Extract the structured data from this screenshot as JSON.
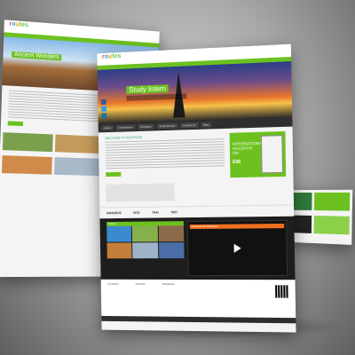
{
  "back_page": {
    "hero_title": "Ancient Wonders"
  },
  "front_page": {
    "nav_items": [
      "Home",
      "Destinations",
      "Packages",
      "Study Abroad",
      "Contact Us",
      "Blog"
    ],
    "hero_title": "Study Intern",
    "welcome_heading": "WELCOME TO ROUTES4U",
    "promo_text": "INTERNATIONAL HOLIDAYS ON",
    "promo_emi": "EMI",
    "partners": [
      "AMADEUS",
      "IATA",
      "TAAI",
      "TAFI"
    ],
    "gallery_title": "Gallery",
    "video_title": "International Packages",
    "footer_cols": [
      "Company",
      "Services",
      "Newsletter"
    ]
  },
  "colors": {
    "accent": "#6cc11f",
    "dark": "#2e2e2e",
    "background": "#9a9a9a"
  }
}
